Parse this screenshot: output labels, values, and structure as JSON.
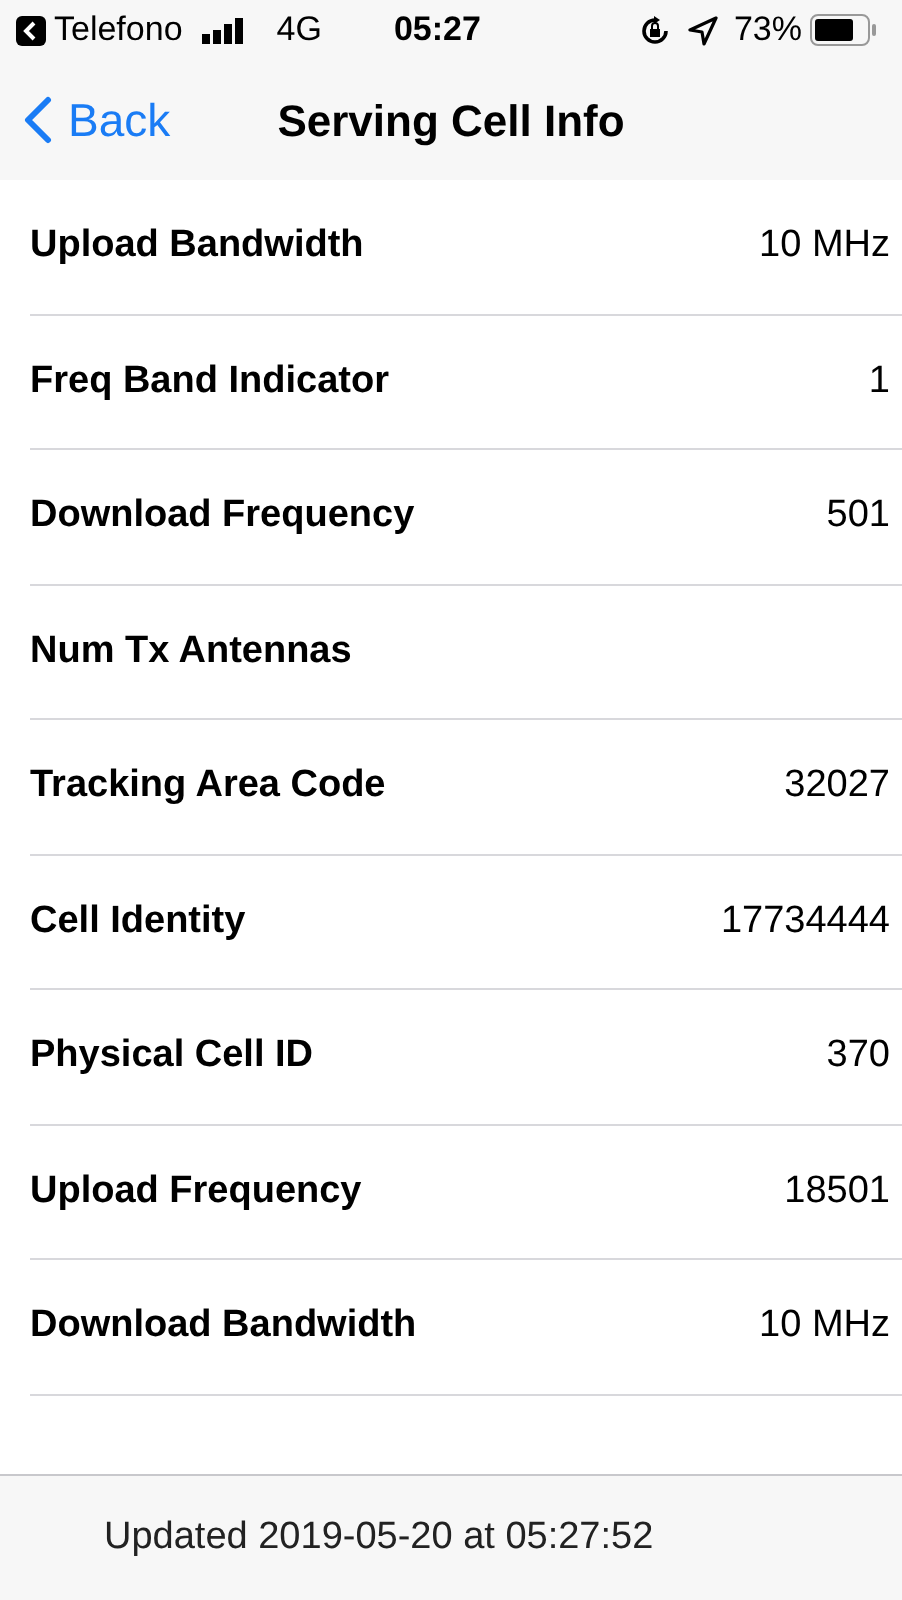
{
  "status_bar": {
    "back_app": "Telefono",
    "network": "4G",
    "time": "05:27",
    "battery": "73%"
  },
  "nav": {
    "back": "Back",
    "title": "Serving Cell Info"
  },
  "rows": [
    {
      "label": "Upload Bandwidth",
      "value": "10 MHz"
    },
    {
      "label": "Freq Band Indicator",
      "value": "1"
    },
    {
      "label": "Download Frequency",
      "value": "501"
    },
    {
      "label": "Num Tx Antennas"
    },
    {
      "label": "Tracking Area Code",
      "value": "32027"
    },
    {
      "label": "Cell Identity",
      "value": "17734444"
    },
    {
      "label": "Physical Cell ID",
      "value": "370"
    },
    {
      "label": "Upload Frequency",
      "value": "18501"
    },
    {
      "label": "Download Bandwidth",
      "value": "10 MHz"
    }
  ],
  "footer": "Updated 2019-05-20 at 05:27:52"
}
